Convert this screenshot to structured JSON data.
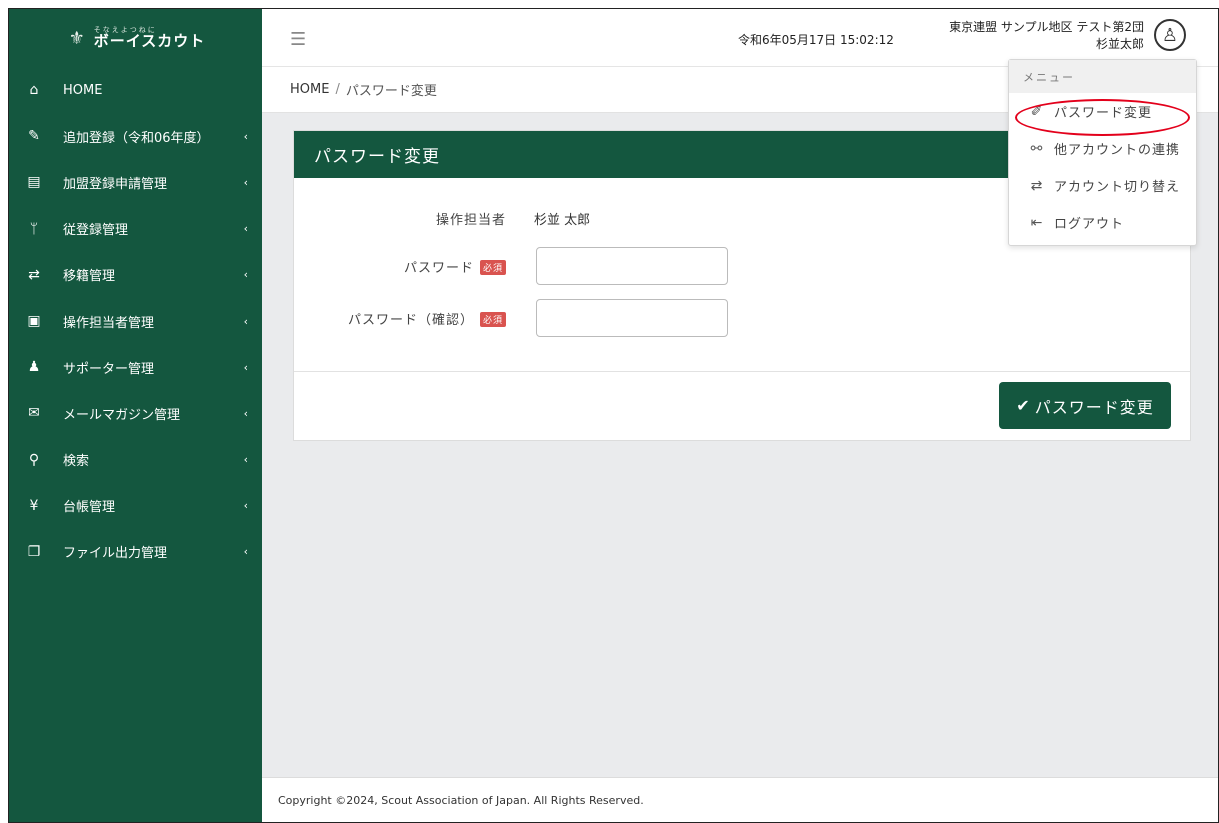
{
  "logo": {
    "emblem": "⚜",
    "subtitle": "そなえよつねに",
    "title": "ボーイスカウト"
  },
  "sidebar": {
    "items": [
      {
        "label": "HOME",
        "icon": "⌂",
        "icon_name": "home-icon",
        "has_chevron": false
      },
      {
        "label": "追加登録（令和06年度）",
        "icon": "✎",
        "icon_name": "edit-icon",
        "has_chevron": true
      },
      {
        "label": "加盟登録申請管理",
        "icon": "▤",
        "icon_name": "id-card-icon",
        "has_chevron": true
      },
      {
        "label": "従登録管理",
        "icon": "ᛘ",
        "icon_name": "branch-icon",
        "has_chevron": true
      },
      {
        "label": "移籍管理",
        "icon": "⇄",
        "icon_name": "transfer-person-icon",
        "has_chevron": true
      },
      {
        "label": "操作担当者管理",
        "icon": "▣",
        "icon_name": "operator-icon",
        "has_chevron": true
      },
      {
        "label": "サポーター管理",
        "icon": "♟",
        "icon_name": "supporter-icon",
        "has_chevron": true
      },
      {
        "label": "メールマガジン管理",
        "icon": "✉",
        "icon_name": "mail-icon",
        "has_chevron": true
      },
      {
        "label": "検索",
        "icon": "⚲",
        "icon_name": "search-icon",
        "has_chevron": true
      },
      {
        "label": "台帳管理",
        "icon": "¥",
        "icon_name": "yen-icon",
        "has_chevron": true
      },
      {
        "label": "ファイル出力管理",
        "icon": "❐",
        "icon_name": "file-output-icon",
        "has_chevron": true
      }
    ]
  },
  "topbar": {
    "datetime": "令和6年05月17日 15:02:12",
    "org": "東京連盟 サンプル地区 テスト第2団",
    "user": "杉並太郎"
  },
  "breadcrumb": {
    "home": "HOME",
    "separator": "/",
    "current": "パスワード変更"
  },
  "card": {
    "title": "パスワード変更",
    "operator_label": "操作担当者",
    "operator_value": "杉並 太郎",
    "password_label": "パスワード",
    "password_confirm_label": "パスワード（確認）",
    "required_badge": "必須",
    "password_value": "",
    "password_confirm_value": "",
    "submit_label": "パスワード変更"
  },
  "dropdown": {
    "header": "メニュー",
    "items": [
      {
        "label": "パスワード変更",
        "icon": "✐",
        "icon_name": "pencil-icon"
      },
      {
        "label": "他アカウントの連携",
        "icon": "⚯",
        "icon_name": "paperclip-icon"
      },
      {
        "label": "アカウント切り替え",
        "icon": "⇄",
        "icon_name": "switch-arrows-icon"
      },
      {
        "label": "ログアウト",
        "icon": "⇤",
        "icon_name": "logout-icon"
      }
    ]
  },
  "footer": {
    "copyright": "Copyright ©2024, Scout Association of Japan. All Rights Reserved."
  },
  "colors": {
    "brand_green": "#14573f",
    "required_red": "#d9534f",
    "highlight_red": "#e3001b",
    "background": "#eaebed"
  }
}
